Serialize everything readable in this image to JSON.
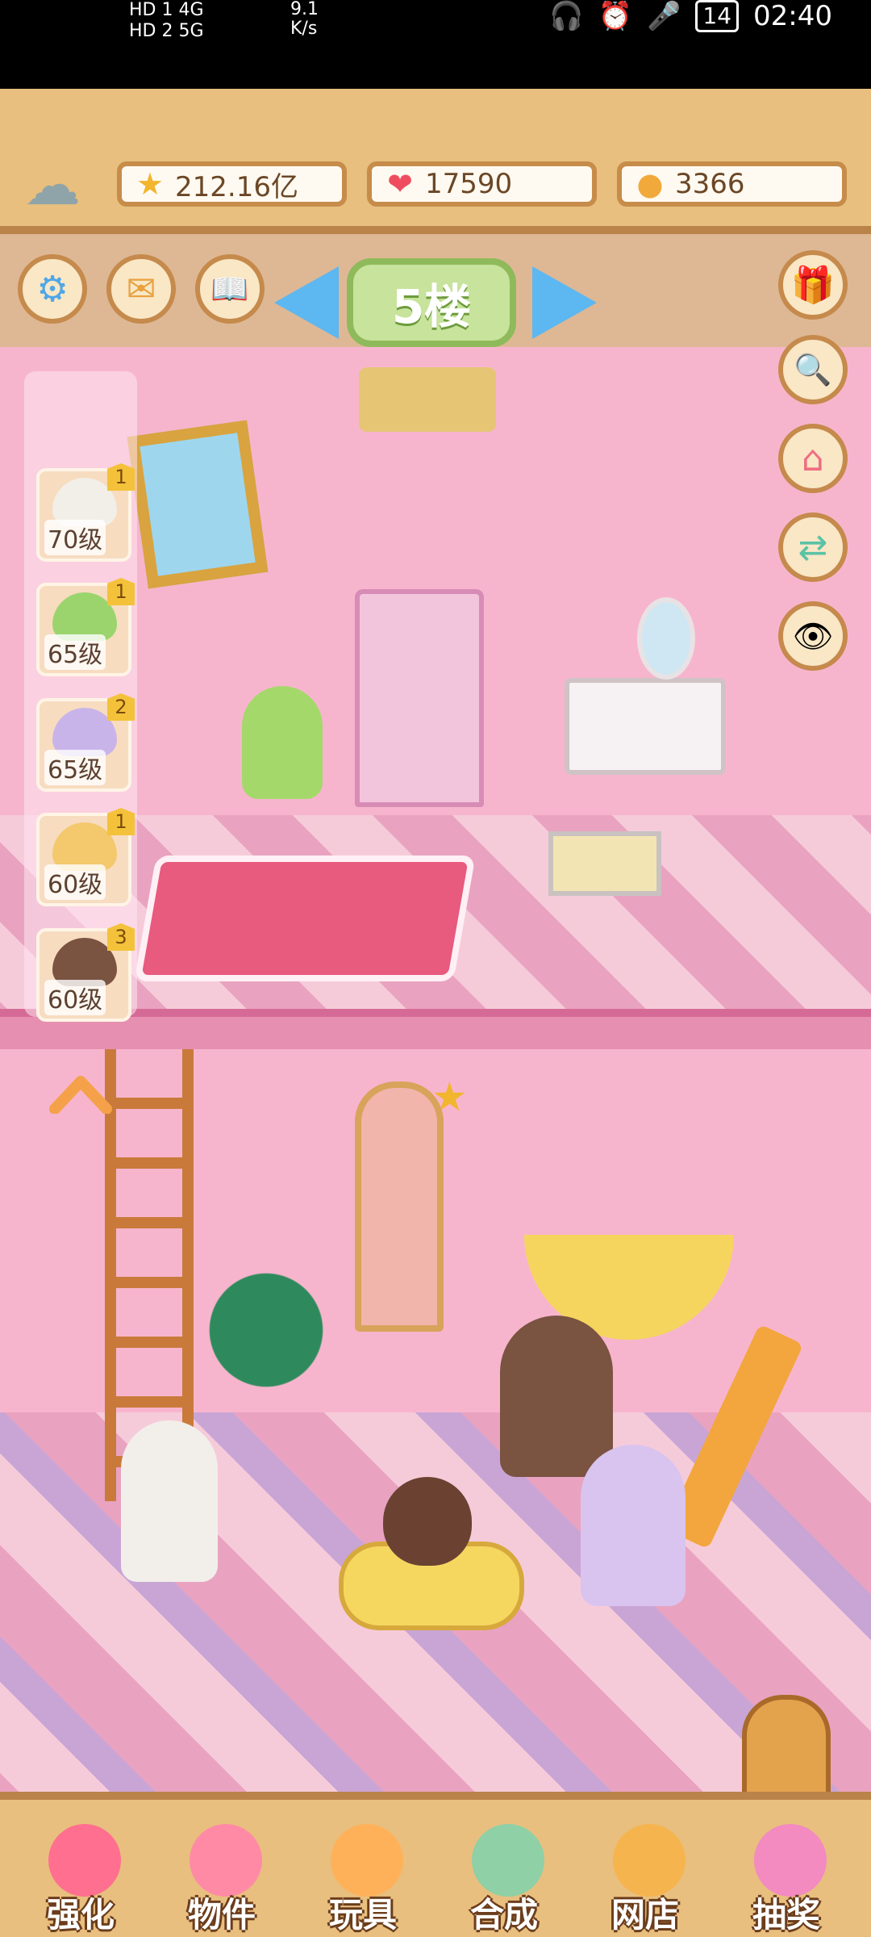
{
  "status_bar": {
    "network_left": "HD 1  4G",
    "network_left2": "HD 2  5G",
    "speed": "9.1\nK/s",
    "battery": "14",
    "time": "02:40"
  },
  "resources": {
    "stars": "212.16亿",
    "hearts": "17590",
    "coins": "3366"
  },
  "floor_sign": "5楼",
  "characters": [
    {
      "level": "70级",
      "rank": "1",
      "color": "#f2efe8"
    },
    {
      "level": "65级",
      "rank": "1",
      "color": "#9bd46d"
    },
    {
      "level": "65级",
      "rank": "2",
      "color": "#c9b4ea"
    },
    {
      "level": "60级",
      "rank": "1",
      "color": "#f4c86c"
    },
    {
      "level": "60级",
      "rank": "3",
      "color": "#7a5341"
    }
  ],
  "bottom_nav": [
    {
      "label": "强化",
      "icon": "lollipop-icon",
      "color": "#ff6f8f"
    },
    {
      "label": "物件",
      "icon": "piano-icon",
      "color": "#ff8aa6"
    },
    {
      "label": "玩具",
      "icon": "toy-house-icon",
      "color": "#ffb15a"
    },
    {
      "label": "合成",
      "icon": "cards-icon",
      "color": "#8fd0a6"
    },
    {
      "label": "网店",
      "icon": "shop-icon",
      "color": "#f5b44e"
    },
    {
      "label": "抽奖",
      "icon": "wheel-icon",
      "color": "#f38ac0"
    }
  ],
  "icons": {
    "weather": "☁",
    "star": "★",
    "heart": "❤",
    "coin": "●",
    "settings": "⚙",
    "mail": "✉",
    "book": "📖",
    "gift": "🎁",
    "search": "🔍",
    "home": "⌂",
    "swap": "⇄",
    "eye": "👁"
  }
}
